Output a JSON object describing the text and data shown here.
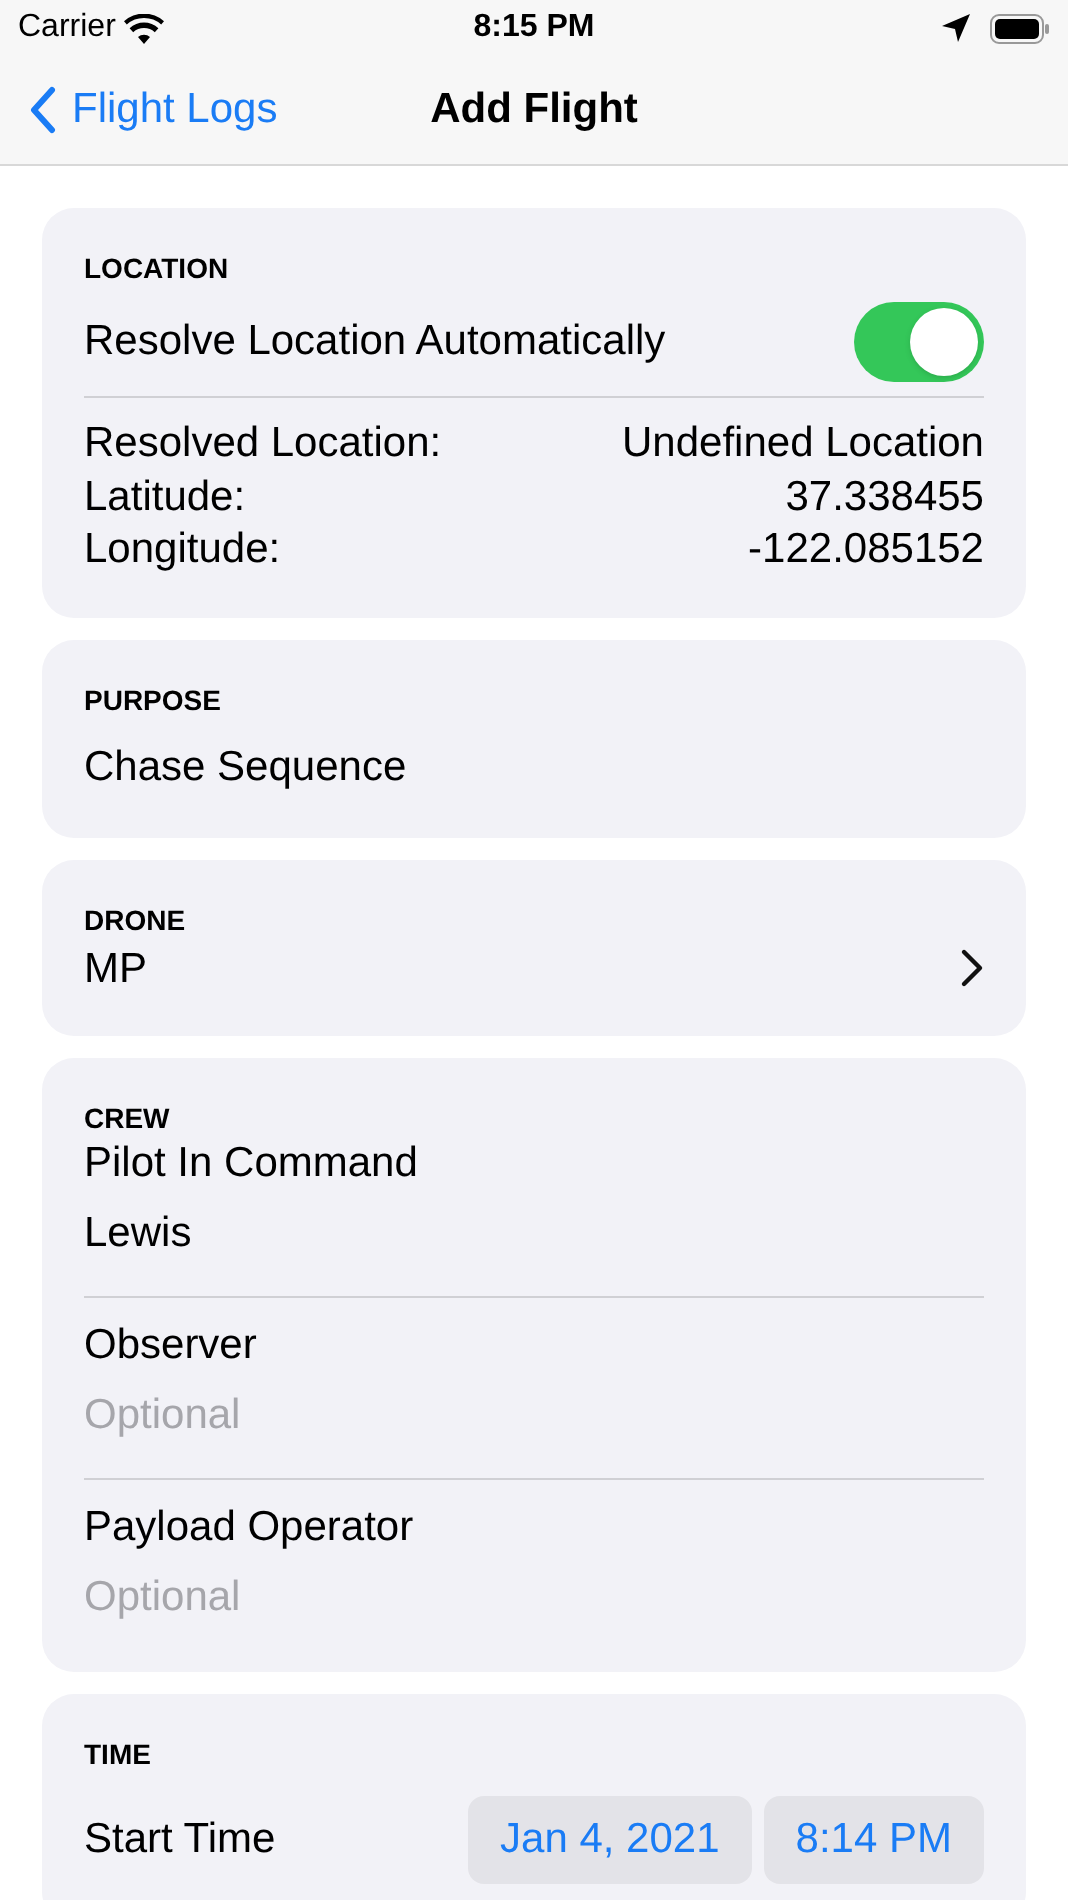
{
  "status_bar": {
    "carrier": "Carrier",
    "time": "8:15 PM"
  },
  "nav": {
    "back_label": "Flight Logs",
    "title": "Add Flight"
  },
  "location": {
    "header": "LOCATION",
    "toggle": {
      "label": "Resolve Location Automatically",
      "on": true
    },
    "rows": [
      {
        "label": "Resolved Location:",
        "value": "Undefined Location"
      },
      {
        "label": "Latitude:",
        "value": "37.338455"
      },
      {
        "label": "Longitude:",
        "value": "-122.085152"
      }
    ]
  },
  "purpose": {
    "header": "PURPOSE",
    "value": "Chase Sequence"
  },
  "drone": {
    "header": "DRONE",
    "value": "MP"
  },
  "crew": {
    "header": "CREW",
    "fields": [
      {
        "label": "Pilot In Command",
        "value": "Lewis"
      },
      {
        "label": "Observer",
        "placeholder": "Optional"
      },
      {
        "label": "Payload Operator",
        "placeholder": "Optional"
      }
    ]
  },
  "time": {
    "header": "TIME",
    "label": "Start Time",
    "date": "Jan 4, 2021",
    "time": "8:14 PM"
  }
}
